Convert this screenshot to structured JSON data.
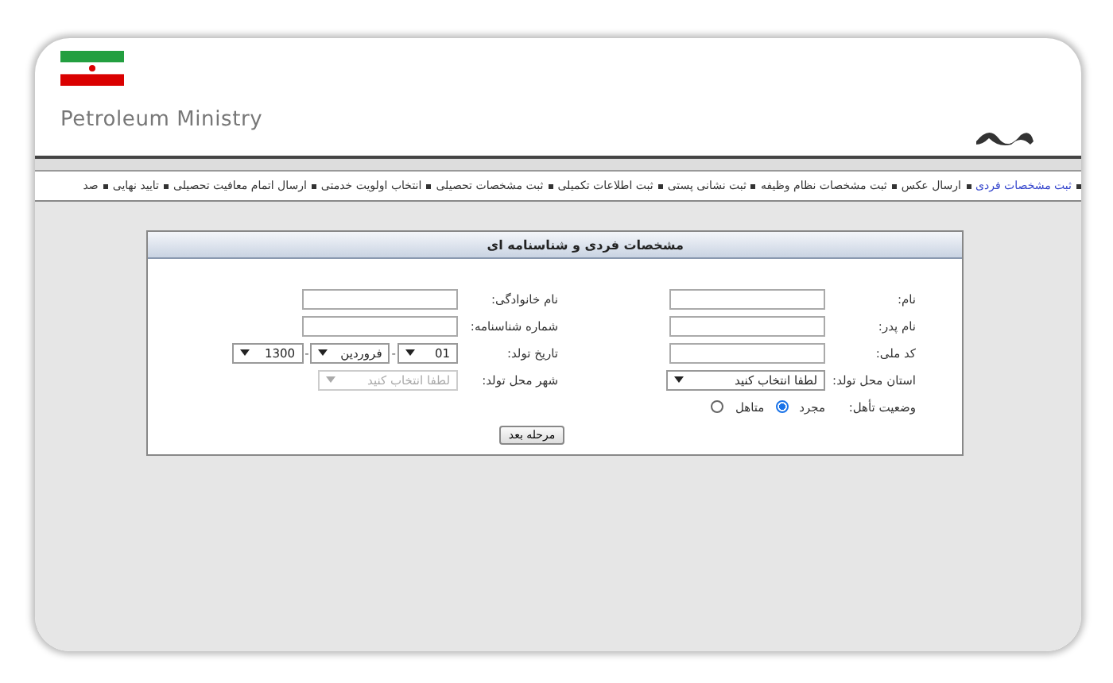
{
  "header": {
    "title": "Petroleum Ministry"
  },
  "nav": {
    "items": [
      {
        "label": "ثبت مشخصات فردی",
        "selected": true
      },
      {
        "label": "ارسال عکس",
        "selected": false
      },
      {
        "label": "ثبت مشخصات نظام وظیفه",
        "selected": false
      },
      {
        "label": "ثبت نشانی پستی",
        "selected": false
      },
      {
        "label": "ثبت اطلاعات تکمیلی",
        "selected": false
      },
      {
        "label": "ثبت مشخصات تحصیلی",
        "selected": false
      },
      {
        "label": "انتخاب اولویت خدمتی",
        "selected": false
      },
      {
        "label": "ارسال اتمام معافیت تحصیلی",
        "selected": false
      },
      {
        "label": "تایید نهایی",
        "selected": false
      },
      {
        "label": "صد",
        "selected": false
      }
    ]
  },
  "form": {
    "title": "مشخصات فردی و شناسنامه ای",
    "rows": [
      {
        "cells": [
          {
            "kind": "text",
            "label": "نام:"
          },
          {
            "kind": "text",
            "label": "نام خانوادگی:"
          }
        ]
      },
      {
        "cells": [
          {
            "kind": "text",
            "label": "نام پدر:"
          },
          {
            "kind": "text",
            "label": "شماره شناسنامه:"
          }
        ]
      },
      {
        "cells": [
          {
            "kind": "text",
            "label": "کد ملی:"
          },
          {
            "kind": "date",
            "label": "تاریخ تولد:",
            "separator": "-",
            "parts": [
              "01",
              "فروردین",
              "1300"
            ]
          }
        ]
      },
      {
        "cells": [
          {
            "kind": "select",
            "label": "استان محل تولد:",
            "value": "لطفا انتخاب کنید",
            "disabled": false
          },
          {
            "kind": "select",
            "label": "شهر محل تولد:",
            "value": "لطفا انتخاب کنید",
            "disabled": true
          }
        ]
      },
      {
        "cells": [
          {
            "kind": "radio",
            "label": "وضعیت تأهل:",
            "options": [
              {
                "label": "مجرد",
                "selected": true
              },
              {
                "label": "متاهل",
                "selected": false
              }
            ]
          }
        ]
      }
    ],
    "button": "مرحله بعد"
  }
}
